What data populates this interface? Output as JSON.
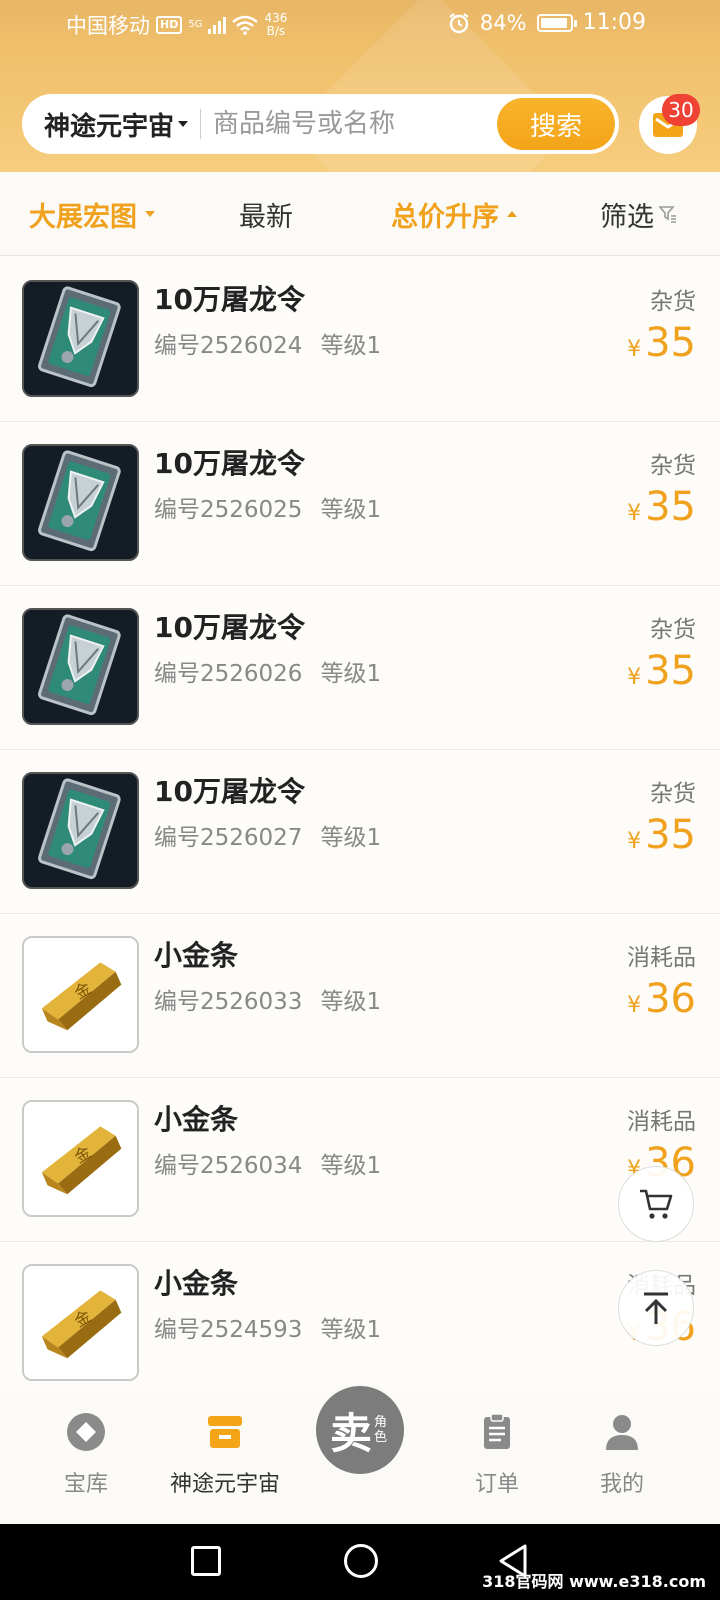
{
  "status_bar": {
    "carrier": "中国移动",
    "hd": "HD",
    "net": "5G",
    "speed_value": "436",
    "speed_unit": "B/s",
    "battery": "84%",
    "time": "11:09"
  },
  "header": {
    "game_selector": "神途元宇宙",
    "search_placeholder": "商品编号或名称",
    "search_button": "搜索",
    "message_count": "30"
  },
  "filters": {
    "category": "大展宏图",
    "latest": "最新",
    "sort": "总价升序",
    "filter": "筛选"
  },
  "items": [
    {
      "name": "10万屠龙令",
      "id": "编号2526024",
      "level": "等级1",
      "category": "杂货",
      "currency": "¥",
      "price": "35",
      "image": "token-card"
    },
    {
      "name": "10万屠龙令",
      "id": "编号2526025",
      "level": "等级1",
      "category": "杂货",
      "currency": "¥",
      "price": "35",
      "image": "token-card"
    },
    {
      "name": "10万屠龙令",
      "id": "编号2526026",
      "level": "等级1",
      "category": "杂货",
      "currency": "¥",
      "price": "35",
      "image": "token-card"
    },
    {
      "name": "10万屠龙令",
      "id": "编号2526027",
      "level": "等级1",
      "category": "杂货",
      "currency": "¥",
      "price": "35",
      "image": "token-card"
    },
    {
      "name": "小金条",
      "id": "编号2526033",
      "level": "等级1",
      "category": "消耗品",
      "currency": "¥",
      "price": "36",
      "image": "gold-bar"
    },
    {
      "name": "小金条",
      "id": "编号2526034",
      "level": "等级1",
      "category": "消耗品",
      "currency": "¥",
      "price": "36",
      "image": "gold-bar"
    },
    {
      "name": "小金条",
      "id": "编号2524593",
      "level": "等级1",
      "category": "消耗品",
      "currency": "¥",
      "price": "36",
      "image": "gold-bar"
    }
  ],
  "floating": {
    "cart_icon": "cart-icon",
    "top_icon": "arrow-up-icon"
  },
  "bottom_nav": {
    "vault": "宝库",
    "game": "神途元宇宙",
    "sell_main": "卖",
    "sell_sub": "角色",
    "orders": "订单",
    "me": "我的"
  },
  "watermark": "318官码网 www.e318.com",
  "colors": {
    "accent": "#f0a21f",
    "header_gradient_top": "#e7b666",
    "header_gradient_bottom": "#f6cd7e",
    "badge": "#ef4134"
  }
}
